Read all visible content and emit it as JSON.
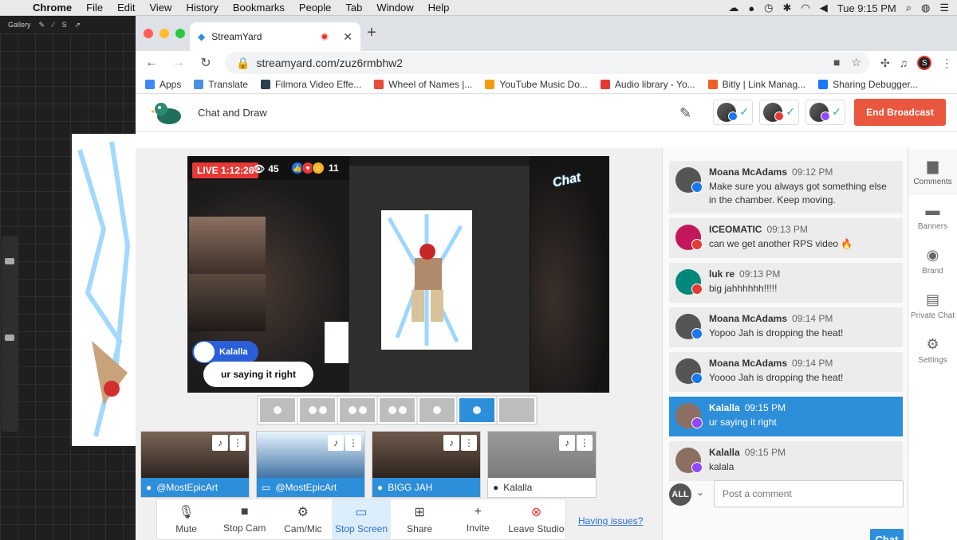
{
  "menubar": {
    "apple": "",
    "items": [
      "Chrome",
      "File",
      "Edit",
      "View",
      "History",
      "Bookmarks",
      "People",
      "Tab",
      "Window",
      "Help"
    ],
    "clock": "Tue 9:15 PM"
  },
  "procreate": {
    "gallery_label": "Gallery"
  },
  "browser": {
    "tab_title": "StreamYard",
    "url": "streamyard.com/zuz6rmbhw2",
    "profile_initial": "S",
    "bookmarks": [
      {
        "label": "Apps",
        "color": "#4285f4"
      },
      {
        "label": "Translate",
        "color": "#4a90e2"
      },
      {
        "label": "Filmora Video Effe...",
        "color": "#2c3e50"
      },
      {
        "label": "Wheel of Names |...",
        "color": "#e74c3c"
      },
      {
        "label": "YouTube Music Do...",
        "color": "#f39c12"
      },
      {
        "label": "Audio library - Yo...",
        "color": "#e53935"
      },
      {
        "label": "Bitly | Link Manag...",
        "color": "#ee6123"
      },
      {
        "label": "Sharing Debugger...",
        "color": "#1877f2"
      }
    ]
  },
  "studio": {
    "title": "Chat and Draw",
    "end_button": "End Broadcast",
    "live_timer": "LIVE 1:12:26",
    "viewers": "45",
    "reactions": "11",
    "brand_logo": "Chat",
    "guest_chip": "Kalalla",
    "featured_comment": "ur saying it right",
    "cameras": [
      {
        "label": "@MostEpicArt",
        "icon": "person-icon",
        "off": false
      },
      {
        "label": "@MostEpicArt",
        "icon": "monitor-icon",
        "off": false
      },
      {
        "label": "BIGG JAH",
        "icon": "person-icon",
        "off": false
      },
      {
        "label": "Kalalla",
        "icon": "person-icon",
        "off": true
      }
    ],
    "controls": [
      {
        "label": "Mute",
        "icon": "mic-icon",
        "glyph": "🎙"
      },
      {
        "label": "Stop Cam",
        "icon": "camera-icon",
        "glyph": "■"
      },
      {
        "label": "Cam/Mic",
        "icon": "gear-icon",
        "glyph": "⚙"
      },
      {
        "label": "Stop Screen",
        "icon": "screen-icon",
        "glyph": "▭"
      },
      {
        "label": "Share",
        "icon": "share-icon",
        "glyph": "⊞"
      },
      {
        "label": "Invite",
        "icon": "add-person-icon",
        "glyph": "+"
      },
      {
        "label": "Leave Studio",
        "icon": "close-circle-icon",
        "glyph": "⊗"
      }
    ],
    "issues_link": "Having issues?"
  },
  "comments": [
    {
      "name": "Moana McAdams",
      "time": "09:12 PM",
      "text": "Make sure you always got something else in the chamber. Keep moving.",
      "platform": "#1877f2",
      "avatar": "#555",
      "highlight": false
    },
    {
      "name": "ICEOMATIC",
      "time": "09:13 PM",
      "text": "can we get another RPS video 🔥",
      "platform": "#e53935",
      "avatar": "#c2185b",
      "highlight": false
    },
    {
      "name": "luk re",
      "time": "09:13 PM",
      "text": "big jahhhhhh!!!!!",
      "platform": "#e53935",
      "avatar": "#00897b",
      "highlight": false
    },
    {
      "name": "Moana McAdams",
      "time": "09:14 PM",
      "text": "Yopoo Jah is dropping the heat!",
      "platform": "#1877f2",
      "avatar": "#555",
      "highlight": false
    },
    {
      "name": "Moana McAdams",
      "time": "09:14 PM",
      "text": "Yoooo Jah is dropping the heat!",
      "platform": "#1877f2",
      "avatar": "#555",
      "highlight": false
    },
    {
      "name": "Kalalla",
      "time": "09:15 PM",
      "text": "ur saying it right",
      "platform": "#9146ff",
      "avatar": "#8d6e63",
      "highlight": true
    },
    {
      "name": "Kalalla",
      "time": "09:15 PM",
      "text": "kalala",
      "platform": "#9146ff",
      "avatar": "#8d6e63",
      "highlight": false
    }
  ],
  "post": {
    "all_label": "ALL",
    "placeholder": "Post a comment",
    "chat_button": "Chat"
  },
  "rail": [
    {
      "label": "Comments",
      "icon": "comment-icon",
      "glyph": "▆",
      "active": true
    },
    {
      "label": "Banners",
      "icon": "banner-icon",
      "glyph": "▬",
      "active": false
    },
    {
      "label": "Brand",
      "icon": "palette-icon",
      "glyph": "◉",
      "active": false
    },
    {
      "label": "Private Chat",
      "icon": "private-chat-icon",
      "glyph": "▤",
      "active": false
    },
    {
      "label": "Settings",
      "icon": "gear-icon",
      "glyph": "⚙",
      "active": false
    }
  ],
  "colors": {
    "accent": "#2d8ed9",
    "danger": "#e9573f",
    "live": "#e53935"
  }
}
